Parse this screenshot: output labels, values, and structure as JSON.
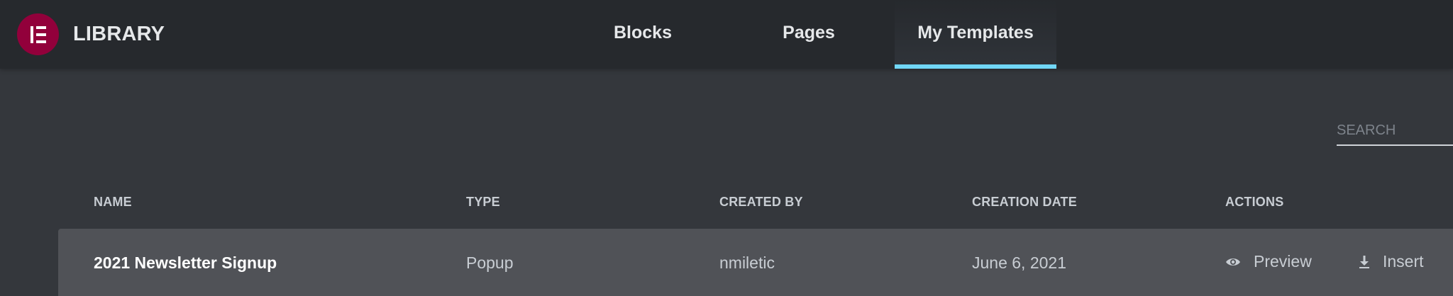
{
  "header": {
    "logo_glyph": "IE",
    "title": "LIBRARY",
    "tabs": [
      {
        "label": "Blocks",
        "active": false
      },
      {
        "label": "Pages",
        "active": false
      },
      {
        "label": "My Templates",
        "active": true
      }
    ]
  },
  "search": {
    "placeholder": "SEARCH",
    "value": ""
  },
  "table": {
    "columns": [
      "NAME",
      "TYPE",
      "CREATED BY",
      "CREATION DATE",
      "ACTIONS"
    ],
    "rows": [
      {
        "name": "2021 Newsletter Signup",
        "type": "Popup",
        "created_by": "nmiletic",
        "creation_date": "June 6, 2021",
        "actions": {
          "preview": "Preview",
          "insert": "Insert"
        }
      }
    ]
  },
  "colors": {
    "brand": "#92003b",
    "active_tab_underline": "#71d7f7",
    "header_bg": "#26292d",
    "body_bg": "#34373c",
    "row_bg": "#505257"
  }
}
